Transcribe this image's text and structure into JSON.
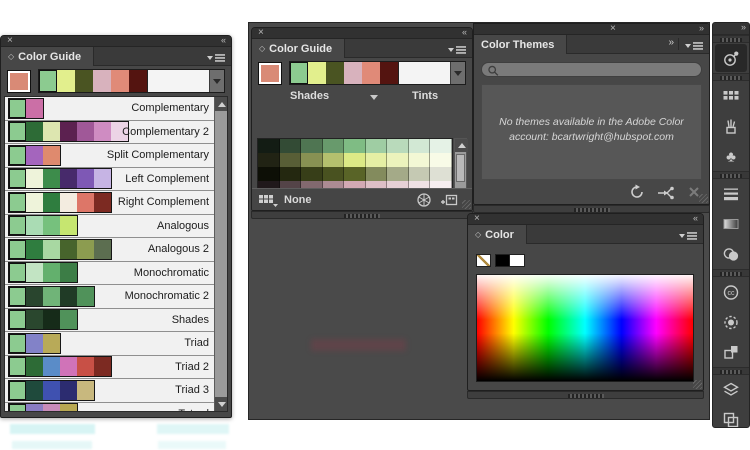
{
  "icons": {
    "close": "×",
    "collapse_left": "«",
    "collapse_right": "»"
  },
  "left_color_guide": {
    "title": "Color Guide",
    "base_color": "#d98a76",
    "group_swatches": [
      "#8ccb90",
      "#e2ef8d",
      "#4a5422",
      "#d8b2bd",
      "#e08a78",
      "#541410"
    ],
    "rows": [
      {
        "label": "Complementary",
        "chips": [
          "#8ccb90",
          "#cb6fa6"
        ]
      },
      {
        "label": "Complementary 2",
        "chips": [
          "#8ccb90",
          "#2d6b36",
          "#dde6b0",
          "#5c2150",
          "#a05898",
          "#cf8cc2",
          "#ecd4e6"
        ]
      },
      {
        "label": "Split Complementary",
        "chips": [
          "#8ccb90",
          "#a465bd",
          "#df8a6e"
        ]
      },
      {
        "label": "Left Complement",
        "chips": [
          "#8ccb90",
          "#eef3da",
          "#3d8c4b",
          "#472a6b",
          "#7e58b5",
          "#c6b4e4"
        ]
      },
      {
        "label": "Right Complement",
        "chips": [
          "#8ccb90",
          "#eef3da",
          "#2f7d3f",
          "#f3ece0",
          "#dd7668",
          "#7c2a22"
        ]
      },
      {
        "label": "Analogous",
        "chips": [
          "#8ccb90",
          "#aadcb4",
          "#76c17d",
          "#c6e670"
        ]
      },
      {
        "label": "Analogous 2",
        "chips": [
          "#8ccb90",
          "#2f7d3f",
          "#a8d8a2",
          "#47642c",
          "#8c9c50",
          "#5c6e50"
        ]
      },
      {
        "label": "Monochromatic",
        "chips": [
          "#8ccb90",
          "#c2e4c3",
          "#63b06d",
          "#3c7d46"
        ]
      },
      {
        "label": "Monochromatic 2",
        "chips": [
          "#8ccb90",
          "#29452e",
          "#70b478",
          "#203b26",
          "#50925a"
        ]
      },
      {
        "label": "Shades",
        "chips": [
          "#8ccb90",
          "#2a472e",
          "#162b19",
          "#50925a"
        ]
      },
      {
        "label": "Triad",
        "chips": [
          "#8ccb90",
          "#8282c8",
          "#b8aa58"
        ]
      },
      {
        "label": "Triad 2",
        "chips": [
          "#8ccb90",
          "#2d6b36",
          "#5a8cc8",
          "#d073b8",
          "#c85046",
          "#7c2a22"
        ]
      },
      {
        "label": "Triad 3",
        "chips": [
          "#8ccb90",
          "#1f4a3c",
          "#3f51b0",
          "#2c2c70",
          "#c8b87e"
        ]
      },
      {
        "label": "Tetrad",
        "chips": [
          "#8ccb90",
          "#8a7cc4",
          "#c88cba",
          "#b8a852"
        ]
      }
    ]
  },
  "middle_color_guide": {
    "title": "Color Guide",
    "base_color": "#d98a76",
    "group_swatches": [
      "#8ccb90",
      "#e2ef8d",
      "#4a5422",
      "#d8b2bd",
      "#e08a78",
      "#541410"
    ],
    "shades_label": "Shades",
    "tints_label": "Tints",
    "none_label": "None",
    "variation_bases": [
      "#7fbc84",
      "#dcea86",
      "#596427",
      "#d2a9b3",
      "#d98a76"
    ],
    "variation_columns": 9,
    "selected_cell": {
      "row": 4,
      "col": 4
    }
  },
  "color_themes": {
    "title": "Color Themes",
    "search_value": "",
    "message_line1": "No themes available in the Adobe Color",
    "message_line2": "account: bcartwright@hubspot.com"
  },
  "color_panel": {
    "title": "Color",
    "none_swatch": "#ffffff",
    "black_swatch": "#000000",
    "white_swatch": "#ffffff",
    "spectrum_hues": [
      "#ff0000",
      "#ffff00",
      "#00ff00",
      "#00ffff",
      "#0000ff",
      "#ff00ff",
      "#ff0000"
    ]
  },
  "dock": {
    "items": [
      {
        "name": "color-guide",
        "selected": true
      },
      {
        "name": "swatches",
        "selected": false
      },
      {
        "name": "brushes",
        "selected": false
      },
      {
        "name": "symbols",
        "selected": false
      },
      {
        "name": "stroke",
        "selected": false
      },
      {
        "name": "gradient",
        "selected": false
      },
      {
        "name": "transparency",
        "selected": false
      },
      {
        "name": "cc-libraries",
        "selected": false
      },
      {
        "name": "dashed-circle",
        "selected": false
      },
      {
        "name": "asset-export",
        "selected": false
      },
      {
        "name": "layers",
        "selected": false
      },
      {
        "name": "artboards",
        "selected": false
      }
    ],
    "groups": [
      [
        0
      ],
      [
        1,
        2,
        3
      ],
      [
        4,
        5,
        6
      ],
      [
        7,
        8,
        9
      ],
      [
        10,
        11
      ]
    ]
  }
}
